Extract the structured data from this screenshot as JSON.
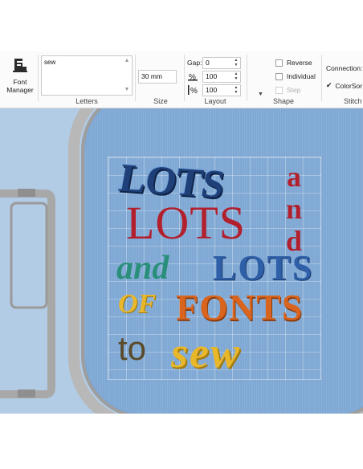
{
  "ribbon": {
    "font_manager_label_1": "Font",
    "font_manager_label_2": "Manager",
    "letters_text": "sew",
    "letters_group_label": "Letters",
    "size_value": "30 mm",
    "size_group_label": "Size",
    "gap_label": "Gap:",
    "gap_value": "0",
    "width_value": "100",
    "height_value": "100",
    "layout_group_label": "Layout",
    "shape_group_label": "Shape",
    "reverse_label": "Reverse",
    "individual_label": "Individual",
    "step_label": "Step",
    "connection_label": "Connection:",
    "colorsort_label": "ColorSor",
    "stitch_group_label": "Stitch"
  },
  "design": {
    "lots1": "LOTS",
    "and1": "and",
    "lots2": "LOTS",
    "and2": "and",
    "lots3": "LOTS",
    "of": "OF",
    "fonts": "FONTS",
    "to": "to",
    "sew": "sew"
  },
  "colors": {
    "canvas_bg": "#b2cce6",
    "fabric": "#7fa8d4",
    "hoop": "#b8b8b8",
    "navy": "#1f3f78",
    "red": "#b21f2d",
    "teal": "#2a8f7a",
    "orange": "#d8641e",
    "yellow": "#e9b72a",
    "olive": "#5a4a2a"
  }
}
